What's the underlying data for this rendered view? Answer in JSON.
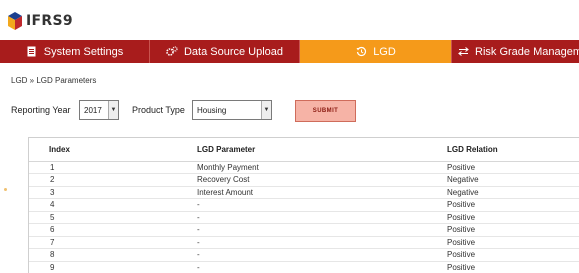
{
  "app": {
    "brand": "IFRS9",
    "logo_icon": "ifrs9-logo-icon"
  },
  "nav": {
    "items": [
      {
        "label": "System Settings",
        "icon": "document-icon",
        "active": false
      },
      {
        "label": "Data Source Upload",
        "icon": "gears-icon",
        "active": false
      },
      {
        "label": "LGD",
        "icon": "history-icon",
        "active": true
      },
      {
        "label": "Risk Grade Managem",
        "icon": "swap-arrows-icon",
        "active": false
      }
    ],
    "colors": {
      "default": "#a81c1c",
      "active": "#f59a1a"
    }
  },
  "breadcrumb": "LGD » LGD Parameters",
  "filters": {
    "reporting_year_label": "Reporting Year",
    "reporting_year_value": "2017",
    "product_type_label": "Product Type",
    "product_type_value": "Housing",
    "submit_label": "SUBMIT"
  },
  "table": {
    "headers": [
      "Index",
      "LGD Parameter",
      "LGD Relation"
    ],
    "rows": [
      [
        "1",
        "Monthly Payment",
        "Positive"
      ],
      [
        "2",
        "Recovery Cost",
        "Negative"
      ],
      [
        "3",
        "Interest Amount",
        "Negative"
      ],
      [
        "4",
        "-",
        "Positive"
      ],
      [
        "5",
        "-",
        "Positive"
      ],
      [
        "6",
        "-",
        "Positive"
      ],
      [
        "7",
        "-",
        "Positive"
      ],
      [
        "8",
        "-",
        "Positive"
      ],
      [
        "9",
        "-",
        "Positive"
      ]
    ]
  }
}
